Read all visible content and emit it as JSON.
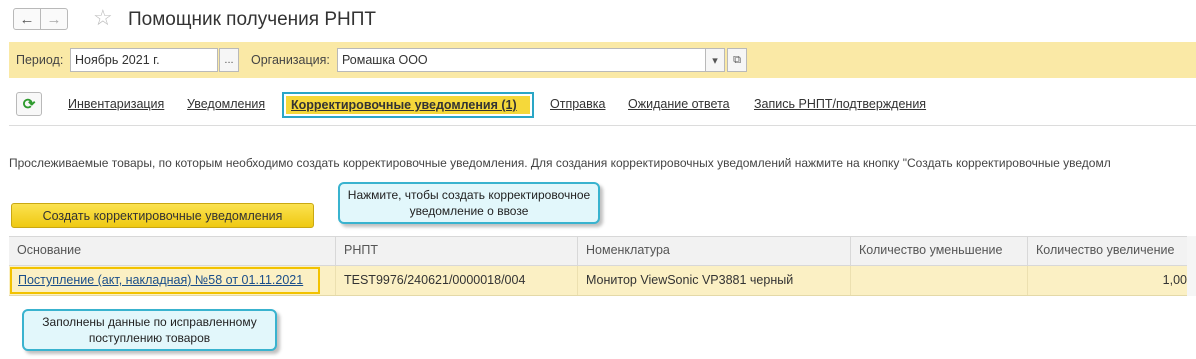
{
  "window": {
    "title": "Помощник получения РНПТ",
    "back_icon": "←",
    "forward_icon": "→",
    "favorite_icon": "☆"
  },
  "filters": {
    "period_label": "Период:",
    "period_value": "Ноябрь 2021 г.",
    "period_select_icon": "...",
    "org_label": "Организация:",
    "org_value": "Ромашка ООО",
    "org_dropdown_icon": "▾",
    "org_open_icon": "⧉"
  },
  "tabs": {
    "refresh_icon": "⟳",
    "items": [
      {
        "label": "Инвентаризация"
      },
      {
        "label": "Уведомления"
      },
      {
        "label": "Корректировочные уведомления (1)"
      },
      {
        "label": "Отправка"
      },
      {
        "label": "Ожидание ответа"
      },
      {
        "label": "Запись РНПТ/подтверждения"
      }
    ],
    "active_index": 2
  },
  "description": "Прослеживаемые товары, по которым необходимо создать корректировочные уведомления. Для создания корректировочных уведомлений нажмите на кнопку \"Создать корректировочные уведомл",
  "create_button": "Создать корректировочные уведомления",
  "callouts": {
    "create_hint": "Нажмите, чтобы создать корректировочное уведомление о ввозе",
    "row_hint": "Заполнены данные по исправленному поступлению товаров"
  },
  "table": {
    "columns": [
      "Основание",
      "РНПТ",
      "Номенклатура",
      "Количество уменьшение",
      "Количество увеличение"
    ],
    "rows": [
      {
        "basis": "Поступление (акт, накладная) №58 от 01.11.2021",
        "rnpt": "TEST9976/240621/0000018/004",
        "nomenclature": "Монитор ViewSonic VP3881 черный",
        "qty_decrease": "",
        "qty_increase": "1,00"
      }
    ]
  },
  "colors": {
    "filter_bar": "#fae9a6",
    "active_tab": "#f5d83a",
    "highlight_border": "#2aa6c6",
    "callout_bg": "#e2f7fb",
    "selected_row": "#fbf0c4"
  }
}
